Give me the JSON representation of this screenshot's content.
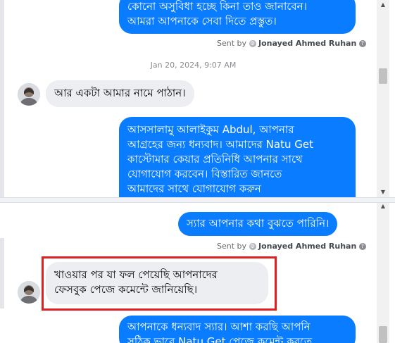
{
  "colors": {
    "outgoing_bubble": "#0a7cff",
    "incoming_bubble": "#eceef1",
    "highlight_border": "#e02020"
  },
  "top_pane": {
    "msg_out_1": {
      "line1": "কোনো অসুবিধা হচ্ছে কিনা তাও জানাবেন।",
      "line2": "আমরা আপনাকে সেবা দিতে প্রস্তুত।"
    },
    "sent_by_1": {
      "prefix": "Sent by",
      "name": "Jonayed Ahmed Ruhan"
    },
    "timestamp": "Jan 20, 2024, 9:07 AM",
    "msg_in_1": "আর একটা আমার নামে পাঠান।",
    "msg_out_2": {
      "line1": "আসসালামু আলাইকুম Abdul, আপনার",
      "line2": "আগ্রহের জন্য ধন্যবাদ। আমাদের Natu Get",
      "line3": "কাস্টোমার কেয়ার প্রতিনিধি আপনার সাথে",
      "line4": "যোগাযোগ করবেন। বিস্তারিত জানতে",
      "line5": "আমাদের সাথে যোগাযোগ করুন"
    }
  },
  "bottom_pane": {
    "msg_out_3": "স্যার আপনার কথা বুঝতে পারিনি।",
    "sent_by_2": {
      "prefix": "Sent by",
      "name": "Jonayed Ahmed Ruhan"
    },
    "msg_in_2": {
      "line1": "খাওয়ার পর যা ফল পেয়েছি আপনাদের",
      "line2": "ফেসবুক পেজে কমেন্টে জানিয়েছি।"
    },
    "msg_out_4": {
      "line1": "আপনাকে ধন্যবাদ স্যার। আশা করছি আপনি",
      "line2": "সঠিক ভাবে Natu Get পেজে কমেন্ট করতে"
    }
  }
}
